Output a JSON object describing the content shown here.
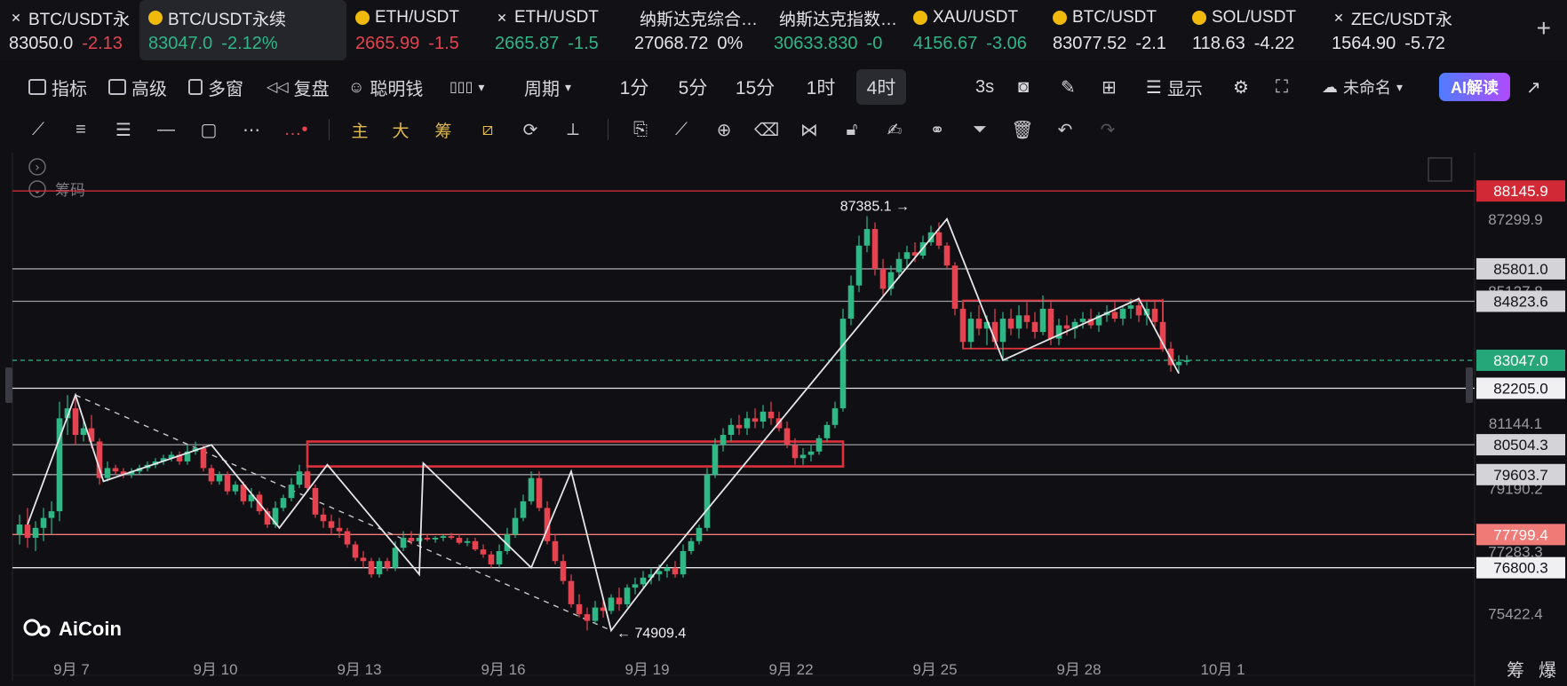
{
  "tickers": [
    {
      "symbol": "BTC/USDT永",
      "price": "83050.0",
      "change": "-2.13",
      "price_dir": "neutral",
      "change_dir": "down",
      "icon": "x-icon",
      "active": false
    },
    {
      "symbol": "BTC/USDT永续",
      "price": "83047.0",
      "change": "-2.12%",
      "price_dir": "up",
      "change_dir": "up",
      "icon": "coin-icon",
      "active": true
    },
    {
      "symbol": "ETH/USDT",
      "price": "2665.99",
      "change": "-1.5",
      "price_dir": "down",
      "change_dir": "down",
      "icon": "coin-icon",
      "active": false
    },
    {
      "symbol": "ETH/USDT",
      "price": "2665.87",
      "change": "-1.5",
      "price_dir": "up",
      "change_dir": "up",
      "icon": "x-icon",
      "active": false
    },
    {
      "symbol": "纳斯达克综合…",
      "price": "27068.72",
      "change": "0%",
      "price_dir": "neutral",
      "change_dir": "neutral",
      "icon": "none",
      "active": false
    },
    {
      "symbol": "纳斯达克指数…",
      "price": "30633.830",
      "change": "-0",
      "price_dir": "up",
      "change_dir": "up",
      "icon": "none",
      "active": false
    },
    {
      "symbol": "XAU/USDT",
      "price": "4156.67",
      "change": "-3.06",
      "price_dir": "up",
      "change_dir": "up",
      "icon": "coin-icon",
      "active": false
    },
    {
      "symbol": "BTC/USDT",
      "price": "83077.52",
      "change": "-2.1",
      "price_dir": "neutral",
      "change_dir": "neutral",
      "icon": "coin-icon",
      "active": false
    },
    {
      "symbol": "SOL/USDT",
      "price": "118.63",
      "change": "-4.22",
      "price_dir": "neutral",
      "change_dir": "neutral",
      "icon": "coin-icon",
      "active": false
    },
    {
      "symbol": "ZEC/USDT永",
      "price": "1564.90",
      "change": "-5.72",
      "price_dir": "neutral",
      "change_dir": "neutral",
      "icon": "x-icon",
      "active": false
    }
  ],
  "toolbar": {
    "indicators": "指标",
    "advanced": "高级",
    "multi_window": "多窗",
    "replay": "复盘",
    "smart_money": "聪明钱",
    "period_menu": "周期",
    "periods": [
      "1分",
      "5分",
      "15分",
      "1时",
      "4时"
    ],
    "active_period": "4时",
    "refresh": "3s",
    "display": "显示",
    "layout_name": "未命名",
    "ai_button": "AI解读"
  },
  "draw_tools": {
    "main": "主",
    "big": "大",
    "chips": "筹"
  },
  "chart_labels": {
    "chips_label": "筹码",
    "watermark": "AiCoin",
    "bottom_right_1": "筹",
    "bottom_right_2": "爆"
  },
  "colors": {
    "up": "#2fb785",
    "down": "#e5434f",
    "background": "#101014",
    "accent": "#4f7cff"
  },
  "chart_data": {
    "type": "candlestick",
    "symbol": "BTC/USDT永续",
    "interval": "4时",
    "ylim": [
      74200,
      89300
    ],
    "x_ticks": [
      {
        "label": "9月 7",
        "t": 6.5
      },
      {
        "label": "9月 10",
        "t": 24.5
      },
      {
        "label": "9月 13",
        "t": 42.5
      },
      {
        "label": "9月 16",
        "t": 60.5
      },
      {
        "label": "9月 19",
        "t": 78.5
      },
      {
        "label": "9月 22",
        "t": 96.5
      },
      {
        "label": "9月 25",
        "t": 114.5
      },
      {
        "label": "9月 28",
        "t": 132.5
      },
      {
        "label": "10月 1",
        "t": 150.5
      }
    ],
    "y_ticks": [
      87299.9,
      85127.8,
      81144.1,
      79190.2,
      77283.3,
      75422.4
    ],
    "price_lines": [
      {
        "price": 88145.9,
        "label": "88145.9",
        "style": "red"
      },
      {
        "price": 85801.0,
        "label": "85801.0",
        "style": "gray"
      },
      {
        "price": 84823.6,
        "label": "84823.6",
        "style": "gray"
      },
      {
        "price": 82205.0,
        "label": "82205.0",
        "style": "white"
      },
      {
        "price": 80504.3,
        "label": "80504.3",
        "style": "gray"
      },
      {
        "price": 79603.7,
        "label": "79603.7",
        "style": "gray"
      },
      {
        "price": 77799.4,
        "label": "77799.4",
        "style": "salmon"
      },
      {
        "price": 76800.3,
        "label": "76800.3",
        "style": "white"
      }
    ],
    "current_price": {
      "price": 83047.0,
      "label": "83047.0"
    },
    "high_marker": {
      "t": 112,
      "price": 87385.1,
      "label": "87385.1 →"
    },
    "low_marker": {
      "t": 74,
      "price": 74909.4,
      "label": "← 74909.4"
    },
    "zones": [
      {
        "t0": 36,
        "t1": 103,
        "p0": 79850,
        "p1": 80600
      },
      {
        "t0": 118,
        "t1": 143,
        "p0": 83400,
        "p1": 84850
      }
    ],
    "zigzag": [
      {
        "t": 1,
        "p": 78100
      },
      {
        "t": 7,
        "p": 82000
      },
      {
        "t": 10.5,
        "p": 79400
      },
      {
        "t": 24,
        "p": 80500
      },
      {
        "t": 32.5,
        "p": 78000
      },
      {
        "t": 38.5,
        "p": 79900
      },
      {
        "t": 50,
        "p": 76600
      },
      {
        "t": 50.5,
        "p": 79950
      },
      {
        "t": 64,
        "p": 76800
      },
      {
        "t": 69,
        "p": 79700
      },
      {
        "t": 74,
        "p": 74909.4
      },
      {
        "t": 80,
        "p": 76800
      },
      {
        "t": 116,
        "p": 87300
      },
      {
        "t": 123,
        "p": 83050
      },
      {
        "t": 140,
        "p": 84900
      },
      {
        "t": 145,
        "p": 82650
      }
    ],
    "trendline_dashed": [
      {
        "t": 7,
        "p": 82000
      },
      {
        "t": 74,
        "p": 74909.4
      }
    ],
    "candles": [
      {
        "o": 77800,
        "h": 78400,
        "l": 77500,
        "c": 78100
      },
      {
        "o": 78100,
        "h": 78600,
        "l": 77400,
        "c": 77700
      },
      {
        "o": 77700,
        "h": 78200,
        "l": 77300,
        "c": 78000
      },
      {
        "o": 78000,
        "h": 78600,
        "l": 77600,
        "c": 78300
      },
      {
        "o": 78300,
        "h": 78800,
        "l": 77800,
        "c": 78500
      },
      {
        "o": 78500,
        "h": 81800,
        "l": 78200,
        "c": 81300
      },
      {
        "o": 81300,
        "h": 82000,
        "l": 80800,
        "c": 81600
      },
      {
        "o": 81600,
        "h": 81900,
        "l": 80500,
        "c": 80800
      },
      {
        "o": 80800,
        "h": 81300,
        "l": 80600,
        "c": 81000
      },
      {
        "o": 81000,
        "h": 81400,
        "l": 80400,
        "c": 80600
      },
      {
        "o": 80600,
        "h": 80700,
        "l": 79300,
        "c": 79500
      },
      {
        "o": 79500,
        "h": 80000,
        "l": 79400,
        "c": 79800
      },
      {
        "o": 79800,
        "h": 79900,
        "l": 79600,
        "c": 79700
      },
      {
        "o": 79700,
        "h": 79800,
        "l": 79500,
        "c": 79600
      },
      {
        "o": 79600,
        "h": 79800,
        "l": 79500,
        "c": 79700
      },
      {
        "o": 79700,
        "h": 79900,
        "l": 79600,
        "c": 79800
      },
      {
        "o": 79800,
        "h": 80000,
        "l": 79700,
        "c": 79900
      },
      {
        "o": 79900,
        "h": 80100,
        "l": 79800,
        "c": 80000
      },
      {
        "o": 80000,
        "h": 80200,
        "l": 79900,
        "c": 80100
      },
      {
        "o": 80100,
        "h": 80300,
        "l": 80000,
        "c": 80200
      },
      {
        "o": 80200,
        "h": 80300,
        "l": 79900,
        "c": 80000
      },
      {
        "o": 80000,
        "h": 80500,
        "l": 79900,
        "c": 80300
      },
      {
        "o": 80300,
        "h": 80600,
        "l": 80200,
        "c": 80400
      },
      {
        "o": 80400,
        "h": 80500,
        "l": 79700,
        "c": 79800
      },
      {
        "o": 79800,
        "h": 79900,
        "l": 79300,
        "c": 79400
      },
      {
        "o": 79400,
        "h": 79700,
        "l": 79300,
        "c": 79600
      },
      {
        "o": 79600,
        "h": 79700,
        "l": 79000,
        "c": 79100
      },
      {
        "o": 79100,
        "h": 79400,
        "l": 79000,
        "c": 79300
      },
      {
        "o": 79300,
        "h": 79400,
        "l": 78700,
        "c": 78800
      },
      {
        "o": 78800,
        "h": 79200,
        "l": 78600,
        "c": 79000
      },
      {
        "o": 79000,
        "h": 79100,
        "l": 78400,
        "c": 78500
      },
      {
        "o": 78500,
        "h": 78600,
        "l": 78000,
        "c": 78100
      },
      {
        "o": 78100,
        "h": 78800,
        "l": 78000,
        "c": 78600
      },
      {
        "o": 78600,
        "h": 79000,
        "l": 78500,
        "c": 78900
      },
      {
        "o": 78900,
        "h": 79500,
        "l": 78800,
        "c": 79300
      },
      {
        "o": 79300,
        "h": 79900,
        "l": 79200,
        "c": 79700
      },
      {
        "o": 79700,
        "h": 79900,
        "l": 79100,
        "c": 79200
      },
      {
        "o": 79200,
        "h": 79300,
        "l": 78300,
        "c": 78400
      },
      {
        "o": 78400,
        "h": 78600,
        "l": 78000,
        "c": 78200
      },
      {
        "o": 78200,
        "h": 78400,
        "l": 77800,
        "c": 78000
      },
      {
        "o": 78000,
        "h": 78300,
        "l": 77700,
        "c": 77900
      },
      {
        "o": 77900,
        "h": 78000,
        "l": 77400,
        "c": 77500
      },
      {
        "o": 77500,
        "h": 77600,
        "l": 77000,
        "c": 77100
      },
      {
        "o": 77100,
        "h": 77300,
        "l": 76800,
        "c": 77000
      },
      {
        "o": 77000,
        "h": 77100,
        "l": 76500,
        "c": 76600
      },
      {
        "o": 76600,
        "h": 77100,
        "l": 76500,
        "c": 77000
      },
      {
        "o": 77000,
        "h": 77100,
        "l": 76700,
        "c": 76800
      },
      {
        "o": 76800,
        "h": 77600,
        "l": 76700,
        "c": 77400
      },
      {
        "o": 77400,
        "h": 77900,
        "l": 77300,
        "c": 77700
      },
      {
        "o": 77700,
        "h": 77900,
        "l": 77500,
        "c": 77600
      },
      {
        "o": 77600,
        "h": 77800,
        "l": 77500,
        "c": 77700
      },
      {
        "o": 77700,
        "h": 77800,
        "l": 77600,
        "c": 77650
      },
      {
        "o": 77650,
        "h": 77750,
        "l": 77550,
        "c": 77700
      },
      {
        "o": 77700,
        "h": 77800,
        "l": 77600,
        "c": 77750
      },
      {
        "o": 77750,
        "h": 77850,
        "l": 77650,
        "c": 77700
      },
      {
        "o": 77700,
        "h": 77800,
        "l": 77500,
        "c": 77550
      },
      {
        "o": 77550,
        "h": 77700,
        "l": 77450,
        "c": 77600
      },
      {
        "o": 77600,
        "h": 77700,
        "l": 77300,
        "c": 77350
      },
      {
        "o": 77350,
        "h": 77500,
        "l": 77100,
        "c": 77200
      },
      {
        "o": 77200,
        "h": 77300,
        "l": 76800,
        "c": 76900
      },
      {
        "o": 76900,
        "h": 77500,
        "l": 76800,
        "c": 77300
      },
      {
        "o": 77300,
        "h": 78000,
        "l": 77200,
        "c": 77800
      },
      {
        "o": 77800,
        "h": 78600,
        "l": 77700,
        "c": 78300
      },
      {
        "o": 78300,
        "h": 79000,
        "l": 78200,
        "c": 78800
      },
      {
        "o": 78800,
        "h": 79700,
        "l": 78700,
        "c": 79500
      },
      {
        "o": 79500,
        "h": 79700,
        "l": 78500,
        "c": 78600
      },
      {
        "o": 78600,
        "h": 78800,
        "l": 77500,
        "c": 77600
      },
      {
        "o": 77600,
        "h": 77800,
        "l": 76900,
        "c": 77000
      },
      {
        "o": 77000,
        "h": 77200,
        "l": 76300,
        "c": 76400
      },
      {
        "o": 76400,
        "h": 76600,
        "l": 75600,
        "c": 75700
      },
      {
        "o": 75700,
        "h": 76000,
        "l": 75300,
        "c": 75400
      },
      {
        "o": 75400,
        "h": 75600,
        "l": 74909,
        "c": 75200
      },
      {
        "o": 75200,
        "h": 75800,
        "l": 75100,
        "c": 75600
      },
      {
        "o": 75600,
        "h": 75900,
        "l": 75300,
        "c": 75500
      },
      {
        "o": 75500,
        "h": 76000,
        "l": 75400,
        "c": 75900
      },
      {
        "o": 75900,
        "h": 76200,
        "l": 75500,
        "c": 75700
      },
      {
        "o": 75700,
        "h": 76300,
        "l": 75600,
        "c": 76200
      },
      {
        "o": 76200,
        "h": 76500,
        "l": 76000,
        "c": 76300
      },
      {
        "o": 76300,
        "h": 76700,
        "l": 76200,
        "c": 76500
      },
      {
        "o": 76500,
        "h": 76800,
        "l": 76300,
        "c": 76600
      },
      {
        "o": 76600,
        "h": 76900,
        "l": 76400,
        "c": 76700
      },
      {
        "o": 76700,
        "h": 76900,
        "l": 76500,
        "c": 76800
      },
      {
        "o": 76800,
        "h": 77000,
        "l": 76500,
        "c": 76600
      },
      {
        "o": 76600,
        "h": 77500,
        "l": 76500,
        "c": 77300
      },
      {
        "o": 77300,
        "h": 77700,
        "l": 77200,
        "c": 77600
      },
      {
        "o": 77600,
        "h": 78100,
        "l": 77500,
        "c": 78000
      },
      {
        "o": 78000,
        "h": 79800,
        "l": 77900,
        "c": 79600
      },
      {
        "o": 79600,
        "h": 80700,
        "l": 79500,
        "c": 80500
      },
      {
        "o": 80500,
        "h": 81000,
        "l": 80300,
        "c": 80800
      },
      {
        "o": 80800,
        "h": 81300,
        "l": 80600,
        "c": 81100
      },
      {
        "o": 81100,
        "h": 81400,
        "l": 80800,
        "c": 81000
      },
      {
        "o": 81000,
        "h": 81500,
        "l": 80800,
        "c": 81300
      },
      {
        "o": 81300,
        "h": 81600,
        "l": 81000,
        "c": 81200
      },
      {
        "o": 81200,
        "h": 81700,
        "l": 81000,
        "c": 81500
      },
      {
        "o": 81500,
        "h": 81800,
        "l": 81100,
        "c": 81300
      },
      {
        "o": 81300,
        "h": 81500,
        "l": 80900,
        "c": 81000
      },
      {
        "o": 81000,
        "h": 81200,
        "l": 80400,
        "c": 80500
      },
      {
        "o": 80500,
        "h": 80700,
        "l": 79900,
        "c": 80100
      },
      {
        "o": 80100,
        "h": 80400,
        "l": 79900,
        "c": 80200
      },
      {
        "o": 80200,
        "h": 80500,
        "l": 80000,
        "c": 80300
      },
      {
        "o": 80300,
        "h": 80800,
        "l": 80200,
        "c": 80700
      },
      {
        "o": 80700,
        "h": 81200,
        "l": 80600,
        "c": 81100
      },
      {
        "o": 81100,
        "h": 81800,
        "l": 81000,
        "c": 81600
      },
      {
        "o": 81600,
        "h": 84600,
        "l": 81500,
        "c": 84300
      },
      {
        "o": 84300,
        "h": 85600,
        "l": 84100,
        "c": 85300
      },
      {
        "o": 85300,
        "h": 86800,
        "l": 85100,
        "c": 86500
      },
      {
        "o": 86500,
        "h": 87385,
        "l": 86300,
        "c": 87000
      },
      {
        "o": 87000,
        "h": 87200,
        "l": 85600,
        "c": 85800
      },
      {
        "o": 85800,
        "h": 86100,
        "l": 85000,
        "c": 85200
      },
      {
        "o": 85200,
        "h": 85900,
        "l": 85000,
        "c": 85700
      },
      {
        "o": 85700,
        "h": 86300,
        "l": 85500,
        "c": 86100
      },
      {
        "o": 86100,
        "h": 86500,
        "l": 85800,
        "c": 86300
      },
      {
        "o": 86300,
        "h": 86600,
        "l": 86000,
        "c": 86200
      },
      {
        "o": 86200,
        "h": 86800,
        "l": 86100,
        "c": 86600
      },
      {
        "o": 86600,
        "h": 87100,
        "l": 86500,
        "c": 86900
      },
      {
        "o": 86900,
        "h": 87200,
        "l": 86400,
        "c": 86500
      },
      {
        "o": 86500,
        "h": 86600,
        "l": 85800,
        "c": 85900
      },
      {
        "o": 85900,
        "h": 86000,
        "l": 84400,
        "c": 84600
      },
      {
        "o": 84600,
        "h": 84800,
        "l": 83400,
        "c": 83600
      },
      {
        "o": 83600,
        "h": 84500,
        "l": 83400,
        "c": 84300
      },
      {
        "o": 84300,
        "h": 84700,
        "l": 83800,
        "c": 84000
      },
      {
        "o": 84000,
        "h": 84400,
        "l": 83500,
        "c": 84200
      },
      {
        "o": 84200,
        "h": 84600,
        "l": 83400,
        "c": 83600
      },
      {
        "o": 83600,
        "h": 84500,
        "l": 83100,
        "c": 84300
      },
      {
        "o": 84300,
        "h": 84600,
        "l": 83800,
        "c": 84000
      },
      {
        "o": 84000,
        "h": 84700,
        "l": 83700,
        "c": 84400
      },
      {
        "o": 84400,
        "h": 84800,
        "l": 84000,
        "c": 84200
      },
      {
        "o": 84200,
        "h": 84500,
        "l": 83700,
        "c": 83900
      },
      {
        "o": 83900,
        "h": 85000,
        "l": 83800,
        "c": 84600
      },
      {
        "o": 84600,
        "h": 84800,
        "l": 83500,
        "c": 83700
      },
      {
        "o": 83700,
        "h": 84300,
        "l": 83500,
        "c": 84100
      },
      {
        "o": 84100,
        "h": 84400,
        "l": 83800,
        "c": 84000
      },
      {
        "o": 84000,
        "h": 84300,
        "l": 83700,
        "c": 84200
      },
      {
        "o": 84200,
        "h": 84500,
        "l": 84000,
        "c": 84300
      },
      {
        "o": 84300,
        "h": 84600,
        "l": 84000,
        "c": 84100
      },
      {
        "o": 84100,
        "h": 84500,
        "l": 83900,
        "c": 84400
      },
      {
        "o": 84400,
        "h": 84700,
        "l": 84200,
        "c": 84500
      },
      {
        "o": 84500,
        "h": 84800,
        "l": 84200,
        "c": 84300
      },
      {
        "o": 84300,
        "h": 84700,
        "l": 84100,
        "c": 84600
      },
      {
        "o": 84600,
        "h": 84900,
        "l": 84300,
        "c": 84700
      },
      {
        "o": 84700,
        "h": 84950,
        "l": 84200,
        "c": 84400
      },
      {
        "o": 84400,
        "h": 84800,
        "l": 84100,
        "c": 84600
      },
      {
        "o": 84600,
        "h": 84850,
        "l": 84000,
        "c": 84200
      },
      {
        "o": 84200,
        "h": 84900,
        "l": 83300,
        "c": 83400
      },
      {
        "o": 83400,
        "h": 83600,
        "l": 82700,
        "c": 82900
      },
      {
        "o": 82900,
        "h": 83200,
        "l": 82650,
        "c": 83000
      },
      {
        "o": 83000,
        "h": 83200,
        "l": 82900,
        "c": 83047
      }
    ]
  }
}
